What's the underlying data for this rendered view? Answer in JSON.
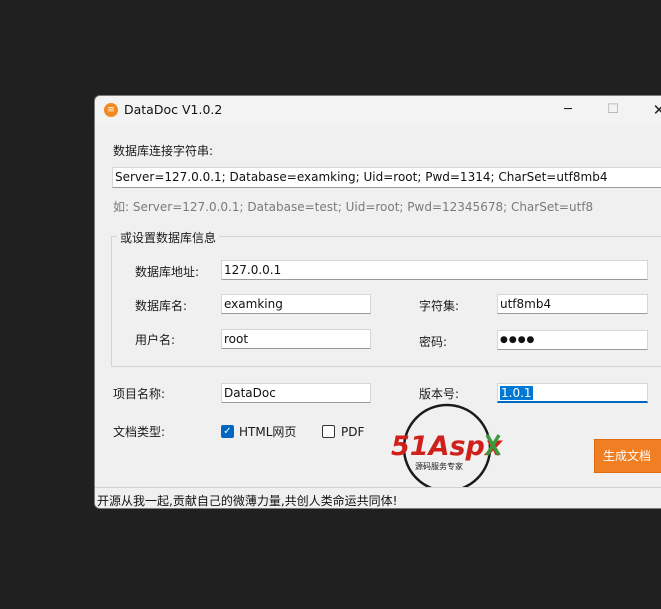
{
  "window": {
    "title": "DataDoc V1.0.2",
    "icon_label": "≡",
    "minimize_glyph": "─",
    "maximize_glyph": "☐",
    "close_glyph": "✕"
  },
  "connection": {
    "label": "数据库连接字符串:",
    "value": "Server=127.0.0.1; Database=examking; Uid=root; Pwd=1314; CharSet=utf8mb4",
    "hint": "如: Server=127.0.0.1; Database=test; Uid=root; Pwd=12345678; CharSet=utf8"
  },
  "group": {
    "title": "或设置数据库信息",
    "address_label": "数据库地址:",
    "address_value": "127.0.0.1",
    "dbname_label": "数据库名:",
    "dbname_value": "examking",
    "charset_label": "字符集:",
    "charset_value": "utf8mb4",
    "user_label": "用户名:",
    "user_value": "root",
    "password_label": "密码:",
    "password_value": "●●●●"
  },
  "project": {
    "name_label": "项目名称:",
    "name_value": "DataDoc",
    "version_label": "版本号:",
    "version_value": "1.0.1"
  },
  "doc_type": {
    "label": "文档类型:",
    "options": [
      {
        "label": "HTML网页",
        "checked": true
      },
      {
        "label": "PDF",
        "checked": false
      }
    ]
  },
  "generate_button": "生成文档",
  "status": "开源从我一起,贡献自己的微薄力量,共创人类命运共同体!",
  "watermark": {
    "brand": "51Aspx",
    "tagline": "源码服务专家"
  },
  "colors": {
    "accent": "#f07f24",
    "checkbox": "#0067c0",
    "selection": "#0078d4",
    "watermark_red": "#d0201c",
    "watermark_green": "#3a9a3a"
  }
}
